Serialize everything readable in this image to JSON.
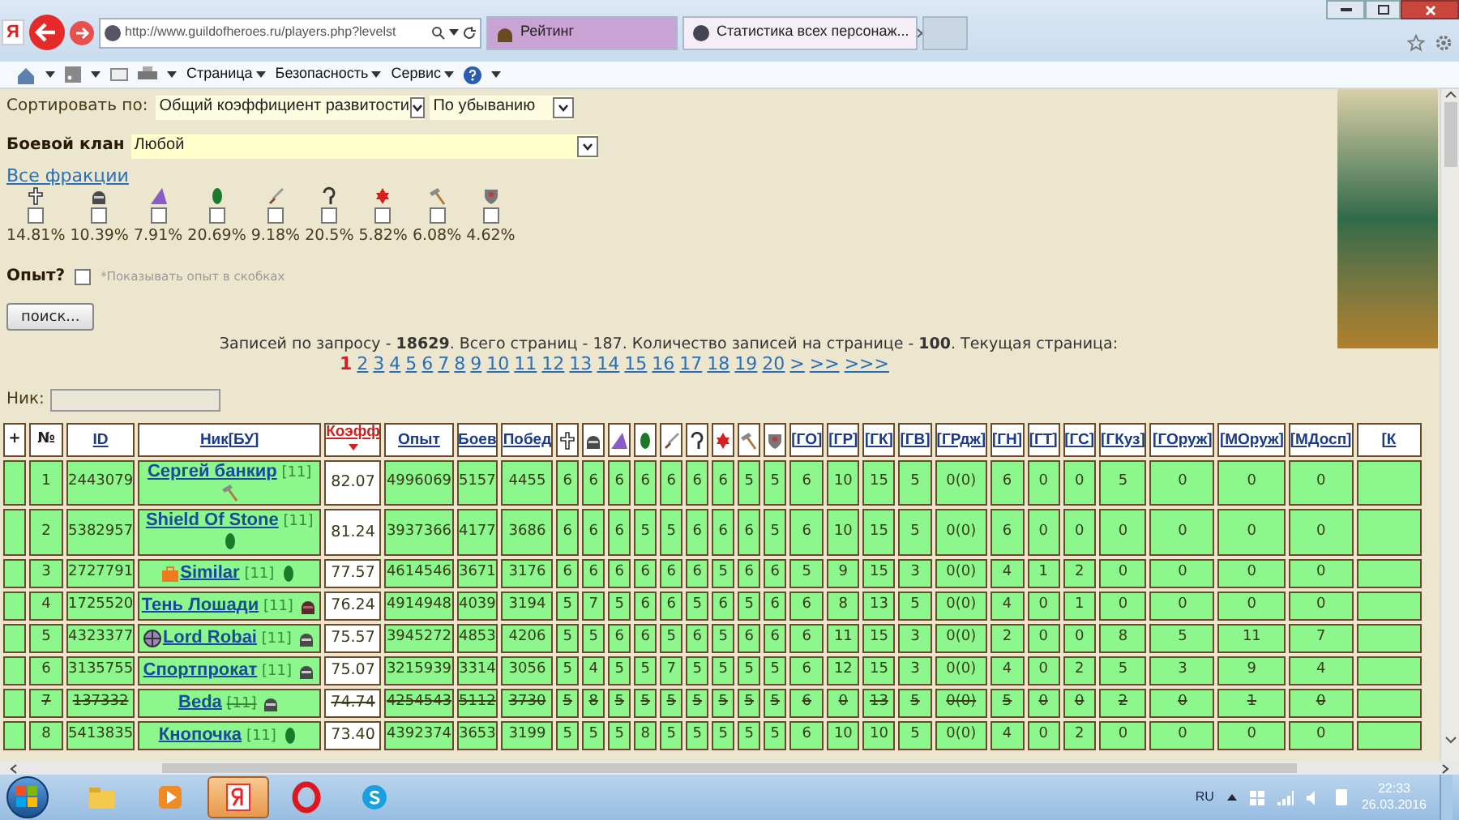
{
  "browser": {
    "logo": "Я",
    "address": "http://www.guildofheroes.ru/players.php?levelst",
    "tabs": [
      {
        "label": "Рейтинг",
        "selected": false
      },
      {
        "label": "Статистика всех персонаж...",
        "selected": true
      }
    ],
    "menu": [
      "Страница",
      "Безопасность",
      "Сервис"
    ]
  },
  "sort": {
    "label": "Сортировать по:",
    "field": "Общий коэффициент развитости",
    "order": "По убыванию"
  },
  "clan": {
    "label": "Боевой клан",
    "value": "Любой"
  },
  "factions": {
    "link": "Все фракции",
    "items": [
      {
        "kind": "knight",
        "share": "14.81%",
        "checked": false
      },
      {
        "kind": "necro",
        "share": "10.39%",
        "checked": false
      },
      {
        "kind": "mage",
        "share": "7.91%",
        "checked": false
      },
      {
        "kind": "elf",
        "share": "20.69%",
        "checked": false
      },
      {
        "kind": "barbarian",
        "share": "9.18%",
        "checked": false
      },
      {
        "kind": "darkelf",
        "share": "20.5%",
        "checked": false
      },
      {
        "kind": "demon",
        "share": "5.82%",
        "checked": false
      },
      {
        "kind": "dwarf",
        "share": "6.08%",
        "checked": false
      },
      {
        "kind": "steppe",
        "share": "4.62%",
        "checked": false
      }
    ]
  },
  "experience": {
    "label": "Опыт?",
    "checked": false,
    "hint": "*Показывать опыт в скобках"
  },
  "search_button": "поиск...",
  "summary": "Записей по запросу - **18629**. Всего страниц - 187. Количество записей на странице - **100**. Текущая страница:",
  "pagination": [
    {
      "label": "1",
      "selected": true
    },
    {
      "label": "2",
      "selected": false
    },
    {
      "label": "3",
      "selected": false
    },
    {
      "label": "4",
      "selected": false
    },
    {
      "label": "5",
      "selected": false
    },
    {
      "label": "6",
      "selected": false
    },
    {
      "label": "7",
      "selected": false
    },
    {
      "label": "8",
      "selected": false
    },
    {
      "label": "9",
      "selected": false
    },
    {
      "label": "10",
      "selected": false
    },
    {
      "label": "11",
      "selected": false
    },
    {
      "label": "12",
      "selected": false
    },
    {
      "label": "13",
      "selected": false
    },
    {
      "label": "14",
      "selected": false
    },
    {
      "label": "15",
      "selected": false
    },
    {
      "label": "16",
      "selected": false
    },
    {
      "label": "17",
      "selected": false
    },
    {
      "label": "18",
      "selected": false
    },
    {
      "label": "19",
      "selected": false
    },
    {
      "label": "20",
      "selected": false
    },
    {
      "label": ">",
      "selected": false
    },
    {
      "label": ">>",
      "selected": false
    },
    {
      "label": ">>>",
      "selected": false
    }
  ],
  "nick_filter": {
    "label": "Ник:"
  },
  "table": {
    "columns": [
      {
        "kind": "text",
        "label": "+"
      },
      {
        "kind": "text",
        "label": "№"
      },
      {
        "kind": "link",
        "label": "ID"
      },
      {
        "kind": "link",
        "label": "Ник[БУ]"
      },
      {
        "kind": "sorted",
        "label": "Коэфф"
      },
      {
        "kind": "link",
        "label": "Опыт"
      },
      {
        "kind": "link",
        "label": "Боев"
      },
      {
        "kind": "link",
        "label": "Побед"
      },
      {
        "kind": "knight"
      },
      {
        "kind": "necro"
      },
      {
        "kind": "mage"
      },
      {
        "kind": "elf"
      },
      {
        "kind": "barbarian"
      },
      {
        "kind": "darkelf"
      },
      {
        "kind": "demon"
      },
      {
        "kind": "dwarf"
      },
      {
        "kind": "steppe"
      },
      {
        "kind": "link",
        "label": "[ГО]"
      },
      {
        "kind": "link",
        "label": "[ГР]"
      },
      {
        "kind": "link",
        "label": "[ГК]"
      },
      {
        "kind": "link",
        "label": "[ГВ]"
      },
      {
        "kind": "link",
        "label": "[ГРдж]"
      },
      {
        "kind": "link",
        "label": "[ГН]"
      },
      {
        "kind": "link",
        "label": "[ГТ]"
      },
      {
        "kind": "link",
        "label": "[ГС]"
      },
      {
        "kind": "link",
        "label": "[ГКуз]"
      },
      {
        "kind": "link",
        "label": "[ГОруж]"
      },
      {
        "kind": "link",
        "label": "[МОруж]"
      },
      {
        "kind": "link",
        "label": "[МДосп]"
      },
      {
        "kind": "link",
        "label": "[К"
      }
    ],
    "rows": [
      {
        "struck": false,
        "cells": [
          "",
          "1",
          "2443079",
          {
            "nick": "Сергей  банкир",
            "level": "[11]",
            "faction": {
              "kind": "dwarf"
            }
          },
          "82.07",
          "4996069",
          "5157",
          "4455",
          "6",
          "6",
          "6",
          "6",
          "6",
          "6",
          "6",
          "5",
          "5",
          "6",
          "10",
          "15",
          "5",
          "0(0)",
          "6",
          "0",
          "0",
          "5",
          "0",
          "0",
          "0",
          ""
        ]
      },
      {
        "struck": false,
        "cells": [
          "",
          "2",
          "5382957",
          {
            "nick": "Shield Of Stone",
            "level": "[11]",
            "faction": {
              "kind": "elf"
            }
          },
          "81.24",
          "3937366",
          "4177",
          "3686",
          "6",
          "6",
          "6",
          "5",
          "5",
          "6",
          "6",
          "6",
          "5",
          "6",
          "10",
          "15",
          "5",
          "0(0)",
          "6",
          "0",
          "0",
          "0",
          "0",
          "0",
          "0",
          ""
        ]
      },
      {
        "struck": false,
        "cells": [
          "",
          "3",
          "2727791",
          {
            "clan": {
              "kind": "briefcase"
            },
            "nick": "Similar",
            "level": "[11]",
            "faction": {
              "kind": "elf"
            }
          },
          "77.57",
          "4614546",
          "3671",
          "3176",
          "6",
          "6",
          "6",
          "6",
          "6",
          "6",
          "5",
          "6",
          "6",
          "5",
          "9",
          "15",
          "3",
          "0(0)",
          "4",
          "1",
          "2",
          "0",
          "0",
          "0",
          "0",
          ""
        ]
      },
      {
        "struck": false,
        "cells": [
          "",
          "4",
          "1725520",
          {
            "nick": "Тень  Лошади",
            "level": "[11]",
            "faction": {
              "kind": "darkhelm"
            }
          },
          "76.24",
          "4914948",
          "4039",
          "3194",
          "5",
          "7",
          "5",
          "6",
          "6",
          "5",
          "6",
          "5",
          "6",
          "6",
          "8",
          "13",
          "5",
          "0(0)",
          "4",
          "0",
          "1",
          "0",
          "0",
          "0",
          "0",
          ""
        ]
      },
      {
        "struck": false,
        "cells": [
          "",
          "5",
          "4323377",
          {
            "clan": {
              "kind": "emblem"
            },
            "nick": "Lord Robai",
            "level": "[11]",
            "faction": {
              "kind": "necro"
            }
          },
          "75.57",
          "3945272",
          "4853",
          "4206",
          "5",
          "5",
          "6",
          "6",
          "5",
          "6",
          "5",
          "6",
          "6",
          "6",
          "11",
          "15",
          "3",
          "0(0)",
          "2",
          "0",
          "0",
          "8",
          "5",
          "11",
          "7",
          ""
        ]
      },
      {
        "struck": false,
        "cells": [
          "",
          "6",
          "3135755",
          {
            "nick": "Спортпрокат",
            "level": "[11]",
            "faction": {
              "kind": "necro"
            }
          },
          "75.07",
          "3215939",
          "3314",
          "3056",
          "5",
          "4",
          "5",
          "5",
          "7",
          "5",
          "5",
          "5",
          "5",
          "6",
          "12",
          "15",
          "3",
          "0(0)",
          "4",
          "0",
          "2",
          "5",
          "3",
          "9",
          "4",
          ""
        ]
      },
      {
        "struck": true,
        "cells": [
          "",
          "7",
          "137332",
          {
            "nick": "Beda",
            "level": "[11]",
            "faction": {
              "kind": "necro"
            }
          },
          "74.74",
          "4254543",
          "5112",
          "3730",
          "5",
          "8",
          "5",
          "5",
          "5",
          "5",
          "5",
          "5",
          "5",
          "6",
          "0",
          "13",
          "5",
          "0(0)",
          "5",
          "0",
          "0",
          "2",
          "0",
          "1",
          "0",
          ""
        ]
      },
      {
        "struck": false,
        "cells": [
          "",
          "8",
          "5413835",
          {
            "nick": "Кнопочка",
            "level": "[11]",
            "faction": {
              "kind": "elf"
            }
          },
          "73.40",
          "4392374",
          "3653",
          "3199",
          "5",
          "5",
          "5",
          "8",
          "5",
          "5",
          "5",
          "5",
          "5",
          "6",
          "10",
          "10",
          "5",
          "0(0)",
          "4",
          "0",
          "2",
          "0",
          "0",
          "0",
          "0",
          ""
        ]
      }
    ]
  },
  "taskbar": {
    "apps": [
      {
        "kind": "explorer",
        "selected": false
      },
      {
        "kind": "media",
        "selected": false
      },
      {
        "kind": "yandex",
        "selected": true
      },
      {
        "kind": "opera",
        "selected": false
      },
      {
        "kind": "skype",
        "selected": false
      }
    ],
    "language": "RU",
    "time": "22:33",
    "date": "26.03.2016"
  }
}
